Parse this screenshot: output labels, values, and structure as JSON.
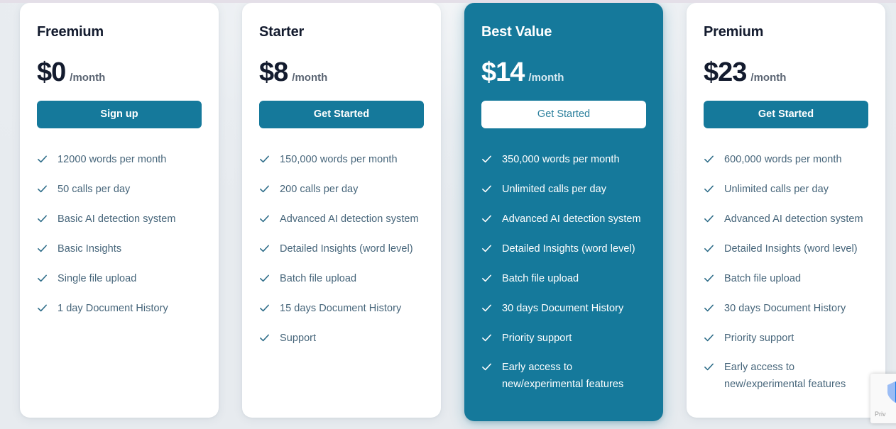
{
  "theme": {
    "accent_color": "#15799B",
    "page_background": "#E9EDF1",
    "top_band_color": "#E4DFE8",
    "price_text_color": "#131B2E",
    "feature_text_color": "#46657A"
  },
  "plans": [
    {
      "name": "Freemium",
      "price": "$0",
      "period": "/month",
      "cta_label": "Sign up",
      "featured": false,
      "features": [
        "12000 words per month",
        "50 calls per day",
        "Basic AI detection system",
        "Basic Insights",
        "Single file upload",
        "1 day Document History"
      ]
    },
    {
      "name": "Starter",
      "price": "$8",
      "period": "/month",
      "cta_label": "Get Started",
      "featured": false,
      "features": [
        "150,000 words per month",
        "200 calls per day",
        "Advanced AI detection system",
        "Detailed Insights (word level)",
        "Batch file upload",
        "15 days Document History",
        "Support"
      ]
    },
    {
      "name": "Best Value",
      "price": "$14",
      "period": "/month",
      "cta_label": "Get Started",
      "featured": true,
      "features": [
        "350,000 words per month",
        "Unlimited calls per day",
        "Advanced AI detection system",
        "Detailed Insights (word level)",
        "Batch file upload",
        "30 days Document History",
        "Priority support",
        "Early access to new/experimental features"
      ]
    },
    {
      "name": "Premium",
      "price": "$23",
      "period": "/month",
      "cta_label": "Get Started",
      "featured": false,
      "features": [
        "600,000 words per month",
        "Unlimited calls per day",
        "Advanced AI detection system",
        "Detailed Insights (word level)",
        "Batch file upload",
        "30 days Document History",
        "Priority support",
        "Early access to new/experimental features"
      ]
    }
  ],
  "recaptcha": {
    "privacy_label": "Priv",
    "icon": "recaptcha-icon"
  },
  "icons": {
    "check": "check-icon"
  }
}
